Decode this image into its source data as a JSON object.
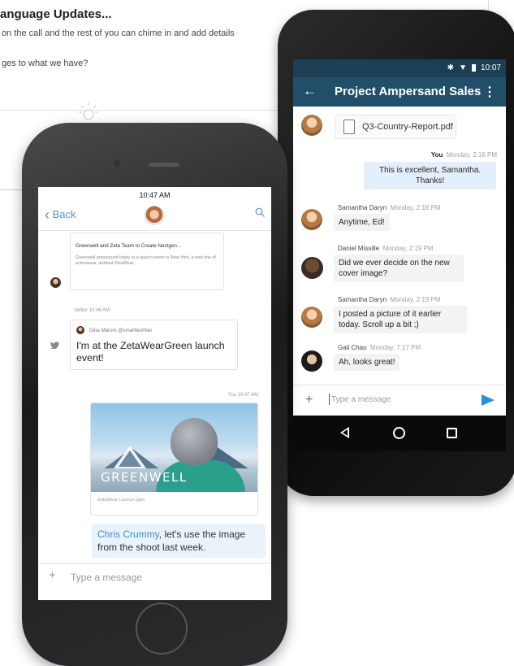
{
  "background_doc": {
    "title": "anguage Updates...",
    "line1": "on the call and the rest of you can chime in and add details",
    "line2": "ges to what we have?"
  },
  "android": {
    "status_time": "10:07",
    "app_title": "Project Ampersand Sales",
    "file_name": "Q3-Country-Report.pdf",
    "messages": [
      {
        "author": "You",
        "time": "Monday, 2:16 PM",
        "text1": "This is excellent, Samantha.",
        "text2": "Thanks!"
      },
      {
        "author": "Samantha Daryn",
        "time": "Monday, 2:18 PM",
        "text1": "Anytime, Ed!"
      },
      {
        "author": "Daniel Missille",
        "time": "Monday, 2:19 PM",
        "text1": "Did we ever decide on the new",
        "text2": "cover image?"
      },
      {
        "author": "Samantha Daryn",
        "time": "Monday, 2:19 PM",
        "text1": "I posted a picture of it earlier",
        "text2": "today. Scroll up a bit ;)"
      },
      {
        "author": "Gail Chao",
        "time": "Monday, 7:17 PM",
        "text1": "Ah, looks great!"
      }
    ],
    "input_placeholder": "Type a message"
  },
  "iphone": {
    "status_time": "10:47 AM",
    "back_label": "Back",
    "news_card": {
      "title": "Greenwell and Zeta Team to Create Nextgen...",
      "body": "Greenwell announced today at a launch event in New York, a new line of activewear, dubbed ZetaWear"
    },
    "tweet_meta": "twitter  10:46 AM",
    "tweet_user": "Dina Maroni @smarttechfan",
    "tweet_text": "I'm at the ZetaWearGreen launch event!",
    "own_meta": "You  10:47 AM",
    "image_brand": "GREENWELL",
    "image_caption": "ZetaWear Launch.pptx",
    "mention": "Chris Crummy",
    "message_rest": ", let's use the image from the shoot last week.",
    "input_placeholder": "Type a message"
  },
  "colors": {
    "android_appbar": "#214f69",
    "android_status": "#1c3f54",
    "own_bubble": "#e3f0fb",
    "ios_accent": "#5f8fc7",
    "send_icon": "#2a8fd9"
  }
}
